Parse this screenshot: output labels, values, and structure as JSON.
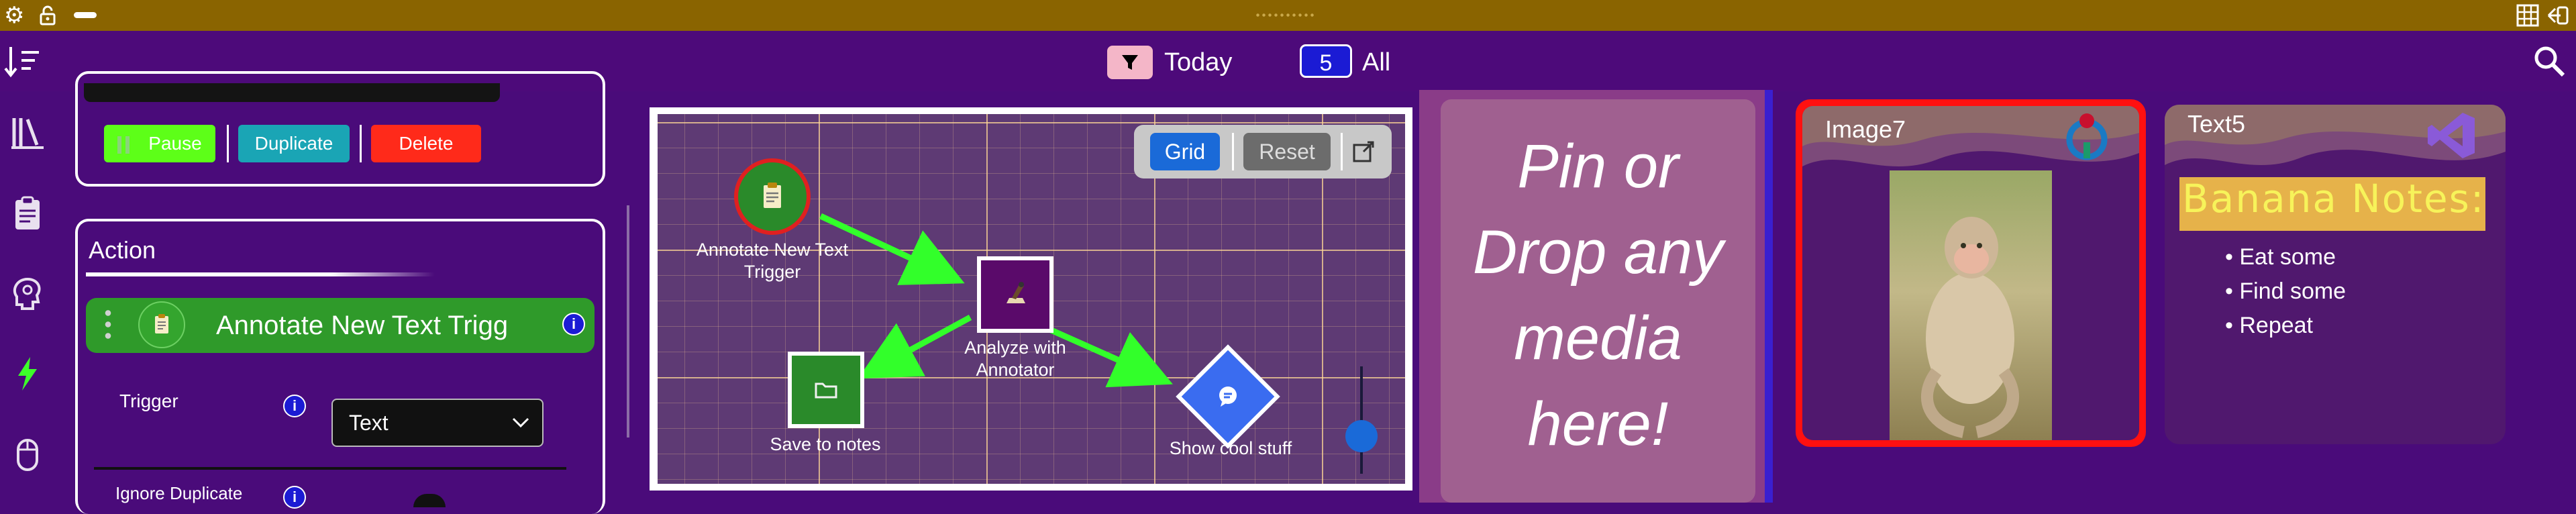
{
  "topbar": {
    "settings_icon": "gear-icon",
    "lock_icon": "unlocked-padlock-icon",
    "grid_icon": "grid-icon",
    "exit_icon": "exit-arrow-icon"
  },
  "header": {
    "filter_icon": "filter-icon",
    "today_label": "Today",
    "count": "5",
    "all_label": "All",
    "sort_icon": "sort-icon",
    "search_icon": "search-icon"
  },
  "rail": {
    "items": [
      "library-icon",
      "clipboard-icon",
      "brain-icon",
      "bolt-icon",
      "mouse-icon"
    ]
  },
  "controls": {
    "pause_label": "Pause",
    "duplicate_label": "Duplicate",
    "delete_label": "Delete"
  },
  "action": {
    "heading": "Action",
    "name": "Annotate New Text Trigg",
    "trigger_label": "Trigger",
    "trigger_value": "Text",
    "ignore_label": "Ignore Duplicate"
  },
  "flow": {
    "grid_label": "Grid",
    "reset_label": "Reset",
    "nodes": [
      {
        "label_line1": "Annotate New Text",
        "label_line2": "Trigger"
      },
      {
        "label_line1": "Analyze with",
        "label_line2": "Annotator"
      },
      {
        "label_line1": "Save to notes",
        "label_line2": ""
      },
      {
        "label_line1": "Show cool stuff",
        "label_line2": ""
      }
    ]
  },
  "dropzone": {
    "lines": [
      "Pin or",
      "Drop any",
      "media",
      "here!"
    ]
  },
  "cards": [
    {
      "title": "Image7"
    },
    {
      "title": "Text5",
      "note_title": "Banana Notes:",
      "bullets": [
        "Eat some",
        "Find some",
        "Repeat"
      ]
    }
  ],
  "colors": {
    "accent_purple": "#4a0b7a",
    "gold_bar": "#8a6400",
    "pause_green": "#5dff18",
    "duplicate_teal": "#1aa5b5",
    "delete_red": "#ff2a1a",
    "action_green": "#2f9a2a",
    "selected_red": "#ff1010"
  }
}
